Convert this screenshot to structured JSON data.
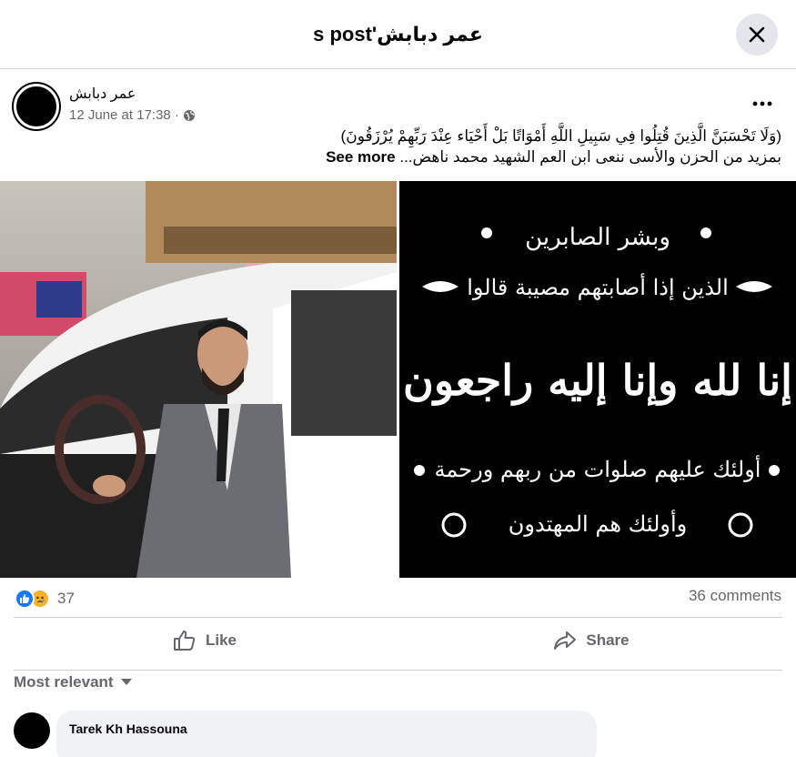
{
  "modal": {
    "title": "عمر دبابش's post",
    "close_icon": "close-icon"
  },
  "post": {
    "author": "عمر دبابش",
    "timestamp": "12 June at 17:38 ·",
    "audience_icon": "globe-icon",
    "more_icon": "more-horizontal-icon",
    "text_line1": "(وَلَا تَحْسَبَنَّ الَّذِينَ قُتِلُوا فِي سَبِيلِ اللَّهِ أَمْوَاتًا بَلْ أَحْيَاء عِنْدَ رَبِّهِمْ يُرْزَقُونَ)",
    "text_line2": "بمزيد من الحزن والأسى  ننعى ابن العم الشهيد محمد ناهض...",
    "see_more": "See more"
  },
  "condolence_card": {
    "line1": "وبشر الصابرين",
    "line2": "الذين إذا أصابتهم مصيبة قالوا",
    "line3": "إنا لله وإنا إليه راجعون",
    "line4": "أولئك عليهم صلوات من ربهم ورحمة",
    "line5": "وأولئك هم المهتدون"
  },
  "stats": {
    "reaction_icons": [
      "like-reaction-icon",
      "sad-reaction-icon"
    ],
    "reaction_count": "37",
    "comments_count": "36 comments"
  },
  "actions": {
    "like_label": "Like",
    "share_label": "Share"
  },
  "comments": {
    "sort_label": "Most relevant",
    "items": [
      {
        "author": "Tarek Kh Hassouna"
      }
    ]
  },
  "colors": {
    "accent": "#1877f2",
    "secondary_text": "#65676b",
    "divider": "#ced0d4",
    "button_bg": "#e4e6eb",
    "sad_reaction": "#f7b125"
  }
}
